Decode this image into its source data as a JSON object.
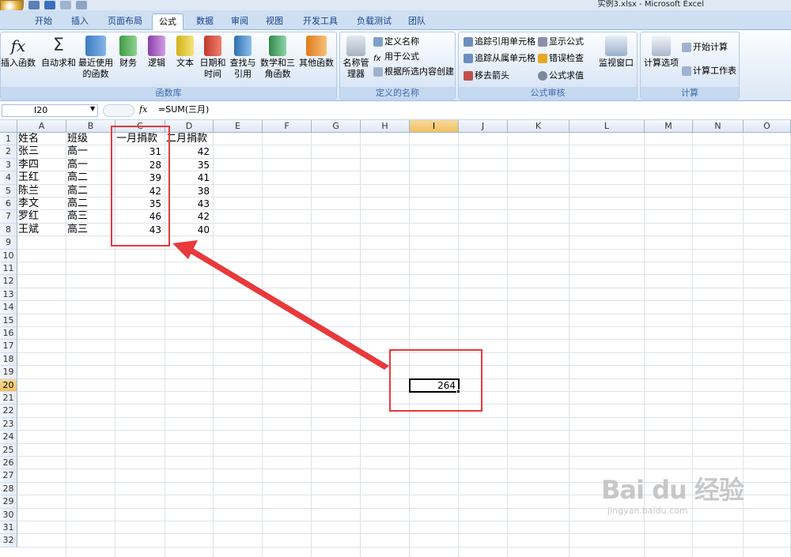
{
  "window": {
    "title": "实例3.xlsx - Microsoft Excel"
  },
  "tabs": [
    "开始",
    "插入",
    "页面布局",
    "公式",
    "数据",
    "审阅",
    "视图",
    "开发工具",
    "负载测试",
    "团队"
  ],
  "ribbon": {
    "lib_group": {
      "label": "函数库",
      "buttons": [
        {
          "label": "插入函数",
          "icon": "fx-icon"
        },
        {
          "label": "自动求和",
          "icon": "sigma-icon"
        },
        {
          "label": "最近使用的函数",
          "icon": "book-star-icon"
        },
        {
          "label": "财务",
          "icon": "book-finance-icon"
        },
        {
          "label": "逻辑",
          "icon": "book-logic-icon"
        },
        {
          "label": "文本",
          "icon": "book-text-icon"
        },
        {
          "label": "日期和时间",
          "icon": "book-date-icon"
        },
        {
          "label": "查找与引用",
          "icon": "book-lookup-icon"
        },
        {
          "label": "数学和三角函数",
          "icon": "book-math-icon"
        },
        {
          "label": "其他函数",
          "icon": "book-more-icon"
        }
      ]
    },
    "names_group": {
      "label": "定义的名称",
      "manager": "名称管理器",
      "define": "定义名称",
      "use": "用于公式",
      "create": "根据所选内容创建"
    },
    "audit_group": {
      "label": "公式审核",
      "trace_prec": "追踪引用单元格",
      "trace_dep": "追踪从属单元格",
      "remove_arrows": "移去箭头",
      "show_formulas": "显示公式",
      "error_check": "错误检查",
      "evaluate": "公式求值",
      "watch": "监视窗口"
    },
    "calc_group": {
      "label": "计算",
      "options": "计算选项",
      "calc_now": "开始计算",
      "calc_sheet": "计算工作表"
    }
  },
  "formula_bar": {
    "name_box": "I20",
    "fx": "fx",
    "formula": "=SUM(三月)"
  },
  "columns": [
    "A",
    "B",
    "C",
    "D",
    "E",
    "F",
    "G",
    "H",
    "I",
    "J",
    "K",
    "L",
    "M",
    "N",
    "O"
  ],
  "rows": [
    "1",
    "2",
    "3",
    "4",
    "5",
    "6",
    "7",
    "8",
    "9",
    "10",
    "11",
    "12",
    "13",
    "14",
    "15",
    "16",
    "17",
    "18",
    "19",
    "20",
    "21",
    "22",
    "23",
    "24",
    "25",
    "26",
    "27",
    "28",
    "29",
    "30",
    "31",
    "32"
  ],
  "sheet": {
    "header": [
      "姓名",
      "班级",
      "一月捐款",
      "二月捐款"
    ],
    "data": [
      [
        "张三",
        "高一",
        "31",
        "42"
      ],
      [
        "李四",
        "高一",
        "28",
        "35"
      ],
      [
        "王红",
        "高二",
        "39",
        "41"
      ],
      [
        "陈兰",
        "高二",
        "42",
        "38"
      ],
      [
        "李文",
        "高二",
        "35",
        "43"
      ],
      [
        "罗红",
        "高三",
        "46",
        "42"
      ],
      [
        "王斌",
        "高三",
        "43",
        "40"
      ]
    ],
    "selected_value": "264"
  },
  "annotation_color": "#e8393b",
  "watermark": {
    "text": "Bai du 经验",
    "url": "jingyan.baidu.com"
  }
}
